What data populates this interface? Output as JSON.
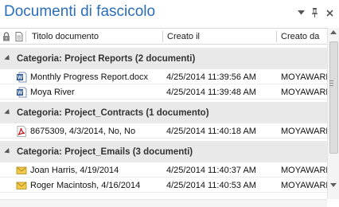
{
  "panel": {
    "title": "Documenti di fascicolo"
  },
  "columns": {
    "title": "Titolo documento",
    "created": "Creato il",
    "created_by": "Creato da"
  },
  "groups": [
    {
      "label": "Categoria: Project Reports (2 documenti)",
      "rows": [
        {
          "icon": "word-document-icon",
          "title": "Monthly Progress Report.docx",
          "created": "4/25/2014 11:39:56 AM",
          "created_by": "MOYAWARE"
        },
        {
          "icon": "word-document-icon",
          "title": "Moya River",
          "created": "4/25/2014 11:39:48 AM",
          "created_by": "MOYAWARE"
        }
      ]
    },
    {
      "label": "Categoria: Project_Contracts (1 documento)",
      "rows": [
        {
          "icon": "pdf-document-icon",
          "title": "8675309, 4/3/2014, No, No",
          "created": "4/25/2014 11:40:18 AM",
          "created_by": "MOYAWARE"
        }
      ]
    },
    {
      "label": "Categoria: Project_Emails (3 documenti)",
      "rows": [
        {
          "icon": "email-envelope-icon",
          "title": "Joan Harris, 4/19/2014",
          "created": "4/25/2014 11:40:37 AM",
          "created_by": "MOYAWARE"
        },
        {
          "icon": "email-envelope-icon",
          "title": "Roger Macintosh, 4/16/2014",
          "created": "4/25/2014 11:40:53 AM",
          "created_by": "MOYAWARE"
        }
      ]
    }
  ],
  "colors": {
    "title": "#2a6db8",
    "group_background": "#e9e9e9",
    "word_blue": "#2b5797",
    "pdf_red": "#c4161c",
    "email_yellow": "#f2c94c"
  }
}
